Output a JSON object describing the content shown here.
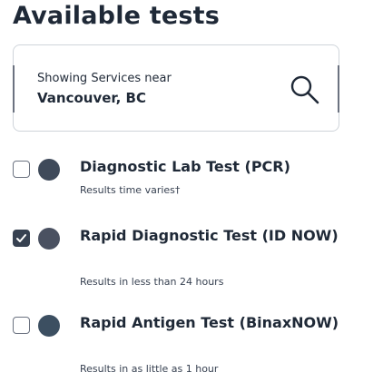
{
  "page": {
    "title": "Available tests"
  },
  "location": {
    "caption": "Showing Services near",
    "city": "Vancouver, BC",
    "search_icon": "magnifier-search-icon"
  },
  "tests": [
    {
      "name": "Diagnostic Lab Test (PCR)",
      "description": "Results time varies†",
      "checked": false,
      "dot_color": "#3f4a5a"
    },
    {
      "name": "Rapid Diagnostic Test (ID NOW)",
      "description": "Results in less than 24 hours",
      "checked": true,
      "dot_color": "#4a5161"
    },
    {
      "name": "Rapid Antigen Test (BinaxNOW)",
      "description": "Results in as little as 1 hour",
      "checked": false,
      "dot_color": "#3c4f61"
    }
  ],
  "colors": {
    "text": "#1f2937",
    "border": "#cfd4da",
    "checkbox_checked": "#374151"
  }
}
